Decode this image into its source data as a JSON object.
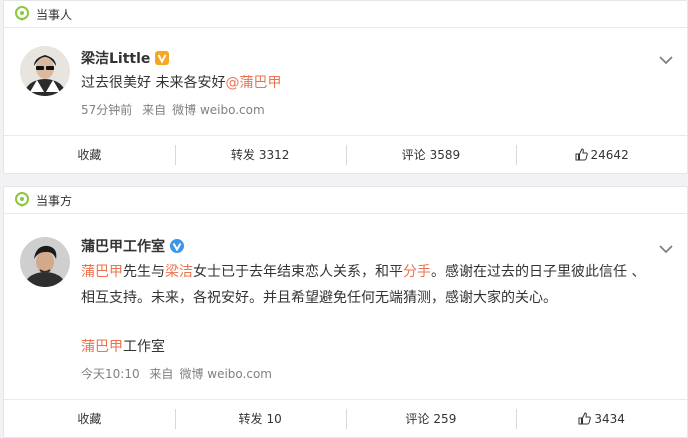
{
  "posts": [
    {
      "tag": "当事人",
      "user_name": "梁洁Little",
      "content_text": "过去很美好 未来各安好",
      "content_mention": "@蒲巴甲",
      "time": "57分钟前",
      "source_prefix": "来自",
      "source": "微博 weibo.com",
      "actions": {
        "favorite": "收藏",
        "repost_label": "转发",
        "repost_count": "3312",
        "comment_label": "评论",
        "comment_count": "3589",
        "like_count": "24642"
      }
    },
    {
      "tag": "当事方",
      "user_name": "蒲巴甲工作室",
      "content": {
        "p1": "蒲巴甲",
        "p2": "先生与",
        "p3": "梁洁",
        "p4": "女士已于去年结束恋人关系，和平",
        "p5": "分手",
        "p6": "。感谢在过去的日子里彼此信任 、",
        "line2": "相互支持。未来，各祝安好。并且希望避免任何无端猜测，感谢大家的关心。"
      },
      "sign_link": "蒲巴甲",
      "sign_rest": "工作室",
      "time": "今天10:10",
      "source_prefix": "来自",
      "source": "微博 weibo.com",
      "actions": {
        "favorite": "收藏",
        "repost_label": "转发",
        "repost_count": "10",
        "comment_label": "评论",
        "comment_count": "259",
        "like_count": "3434"
      }
    }
  ],
  "colors": {
    "link": "#eb7350",
    "tag_icon": "#8dc63f",
    "verified_orange": "#f5a623",
    "verified_blue": "#3b95e8"
  }
}
